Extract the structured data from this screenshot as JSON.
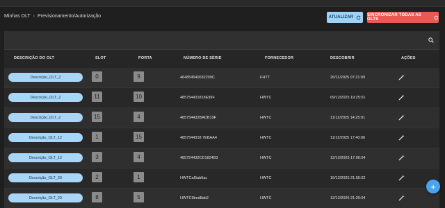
{
  "breadcrumb": {
    "root": "Minhas OLT",
    "separator": "›",
    "current": "Previsionamento/Autorização"
  },
  "actions": {
    "update_label": "ATUALIZAR",
    "sync_label": "SINCRONIZAR TODAS AS OLTS"
  },
  "table": {
    "headers": {
      "descricao": "DESCRIÇÃO DO OLT",
      "slot": "SLOT",
      "porta": "PORTA",
      "serie": "NÚMERO DE SÉRIE",
      "fornecedor": "FORNECEDOR",
      "descobrir": "DESCOBRIR",
      "acoes": "AÇÕES"
    },
    "rows": [
      {
        "descricao": "Descrição_OLT_2",
        "slot": "0",
        "porta": "9",
        "serie": "464854540032209C",
        "fornecedor": "FHTT",
        "descobrir": "26/11/2025 07:21:09"
      },
      {
        "descricao": "Descrição_OLT_2",
        "slot": "11",
        "porta": "10",
        "serie": "485754431818E99F",
        "fornecedor": "HWTC",
        "descobrir": "09/12/2025 19:25:01"
      },
      {
        "descricao": "Descrição_OLT_2",
        "slot": "15",
        "porta": "4",
        "serie": "485754432BADB19F",
        "fornecedor": "HWTC",
        "descobrir": "11/12/2025 14:25:01"
      },
      {
        "descricao": "Descrição_OLT_12",
        "slot": "1",
        "porta": "15",
        "serie": "4857544318 7EBAA4",
        "fornecedor": "HWTC",
        "descobrir": "11/12/2025 17:40:06"
      },
      {
        "descricao": "Descrição_OLT_12",
        "slot": "3",
        "porta": "4",
        "serie": "485754432CD1824B3",
        "fornecedor": "HWTC",
        "descobrir": "12/12/2025 17:00:04"
      },
      {
        "descricao": "Descrição_OLT_20",
        "slot": "2",
        "porta": "1",
        "serie": "HWTCaf5ab6ac",
        "fornecedor": "HWTC",
        "descobrir": "16/12/2025 21:55:02"
      },
      {
        "descricao": "Descrição_OLT_20",
        "slot": "8",
        "porta": "5",
        "serie": "HWTC9bed8ab2",
        "fornecedor": "HWTC",
        "descobrir": "12/12/2025 21:20:04"
      }
    ]
  },
  "fab": {
    "label": "+"
  },
  "colors": {
    "accent": "#9fd2f7",
    "danger": "#ea5a55",
    "pill": "#a9d6f7",
    "fab": "#4aa3ee"
  }
}
